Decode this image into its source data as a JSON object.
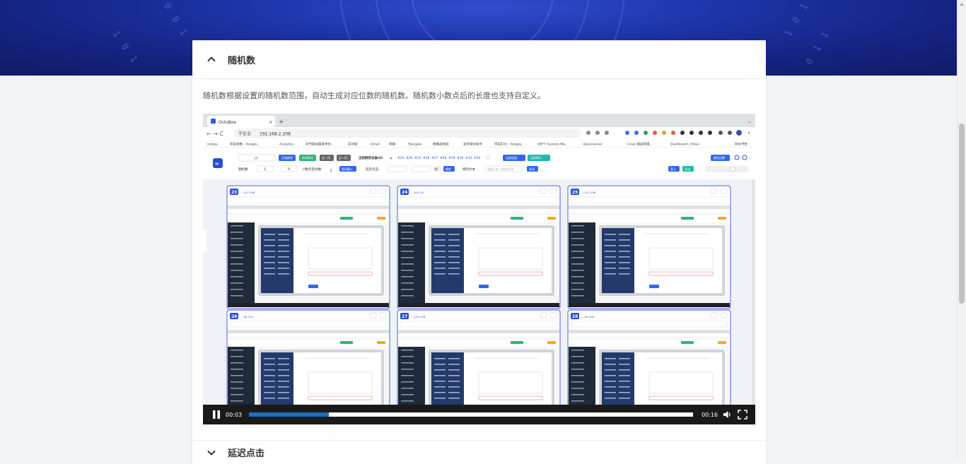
{
  "section1": {
    "title": "随机数",
    "description": "随机数根据设置的随机数范围，自动生成对应位数的随机数。随机数小数点后的长度也支持自定义。"
  },
  "section2": {
    "title": "延迟点击"
  },
  "video": {
    "current_time": "00:03",
    "duration": "00:16",
    "progress": 0.18,
    "browser": {
      "tab_title": "OctoBox",
      "address": "192.168.2.208",
      "insecure_label": "不安全",
      "bookmarks": [
        "nodejs",
        "项目进度 - Google...",
        "Analytics",
        "字节跳动最常考的...",
        "区块链",
        "Gmail",
        "邮箱",
        "Stargate",
        "精确盘他批",
        "道哥埋伏新币",
        "项目打分 - Google...",
        "DEFY Genesis Ma...",
        "dexscreener",
        "Linux 磁盘管理...",
        "Dashboard | Smar...",
        "所有书签"
      ],
      "toolbar": {
        "buttons": [
          "开始群控",
          "结束群控",
          "全一页",
          "后一页"
        ],
        "current_group_label": "当前群控设备(8)",
        "device_tabs": [
          "#23",
          "#24",
          "#25",
          "#26",
          "#27",
          "#28",
          "#29",
          "#30",
          "#31",
          "#32"
        ],
        "select_all": "全部连接",
        "deselect_all": "全部断开",
        "group_settings": "群控设置",
        "random_label": "随机数",
        "random_from": "1",
        "random_to": "9",
        "decimal_label": "小数点后位数:",
        "random_input_btn": "随机輸入",
        "delay_label": "延迟点击:",
        "ms_label": "秒",
        "confirm_btn": "确定",
        "same_text_label": "相同文本",
        "same_text_placeholder": "请输入统一发送的文本",
        "send_btn": "发送",
        "import_btn": "导入",
        "export_btn": "导出"
      },
      "devices": [
        {
          "id": "23",
          "ip": "...107.248"
        },
        {
          "id": "24",
          "ip": "...202.15"
        },
        {
          "id": "25",
          "ip": "...107.236"
        },
        {
          "id": "26",
          "ip": "...90.193"
        },
        {
          "id": "27",
          "ip": "...202.178"
        },
        {
          "id": "28",
          "ip": "...84.128"
        }
      ]
    }
  }
}
